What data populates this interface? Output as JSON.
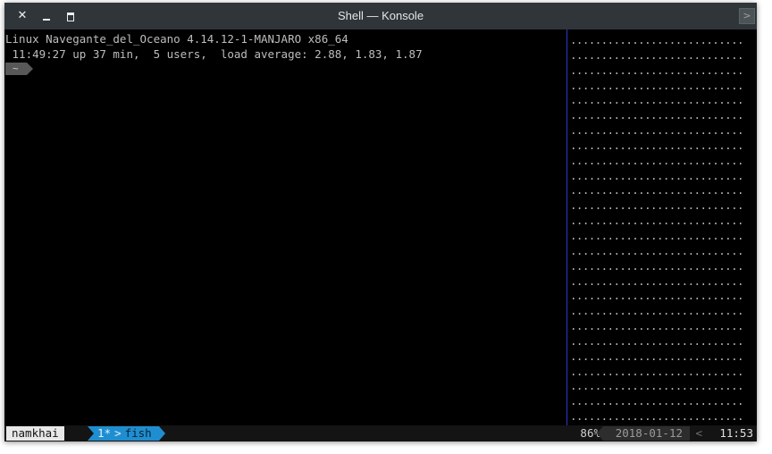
{
  "window": {
    "title": "Shell — Konsole",
    "close_icon": "close-icon",
    "minimize_icon": "minimize-icon",
    "maximize_icon": "maximize-icon",
    "menu_arrow": ">"
  },
  "terminal": {
    "line1": "Linux Navegante_del_Oceano 4.14.12-1-MANJARO x86_64",
    "line2": " 11:49:27 up 37 min,  5 users,  load average: 2.88, 1.83, 1.87",
    "prompt_dir": "~"
  },
  "tmux": {
    "session": "namkhai",
    "window_index": "1*",
    "window_sep": ">",
    "window_name": "fish",
    "zoom": "86%",
    "date": "2018-01-12",
    "time": "11:53",
    "separator": "<"
  },
  "colors": {
    "titlebar": "#2f3539",
    "terminal_bg": "#000000",
    "pane_divider": "#2a3acb",
    "window_tab": "#1f8ed1",
    "prompt_bg": "#585858"
  }
}
